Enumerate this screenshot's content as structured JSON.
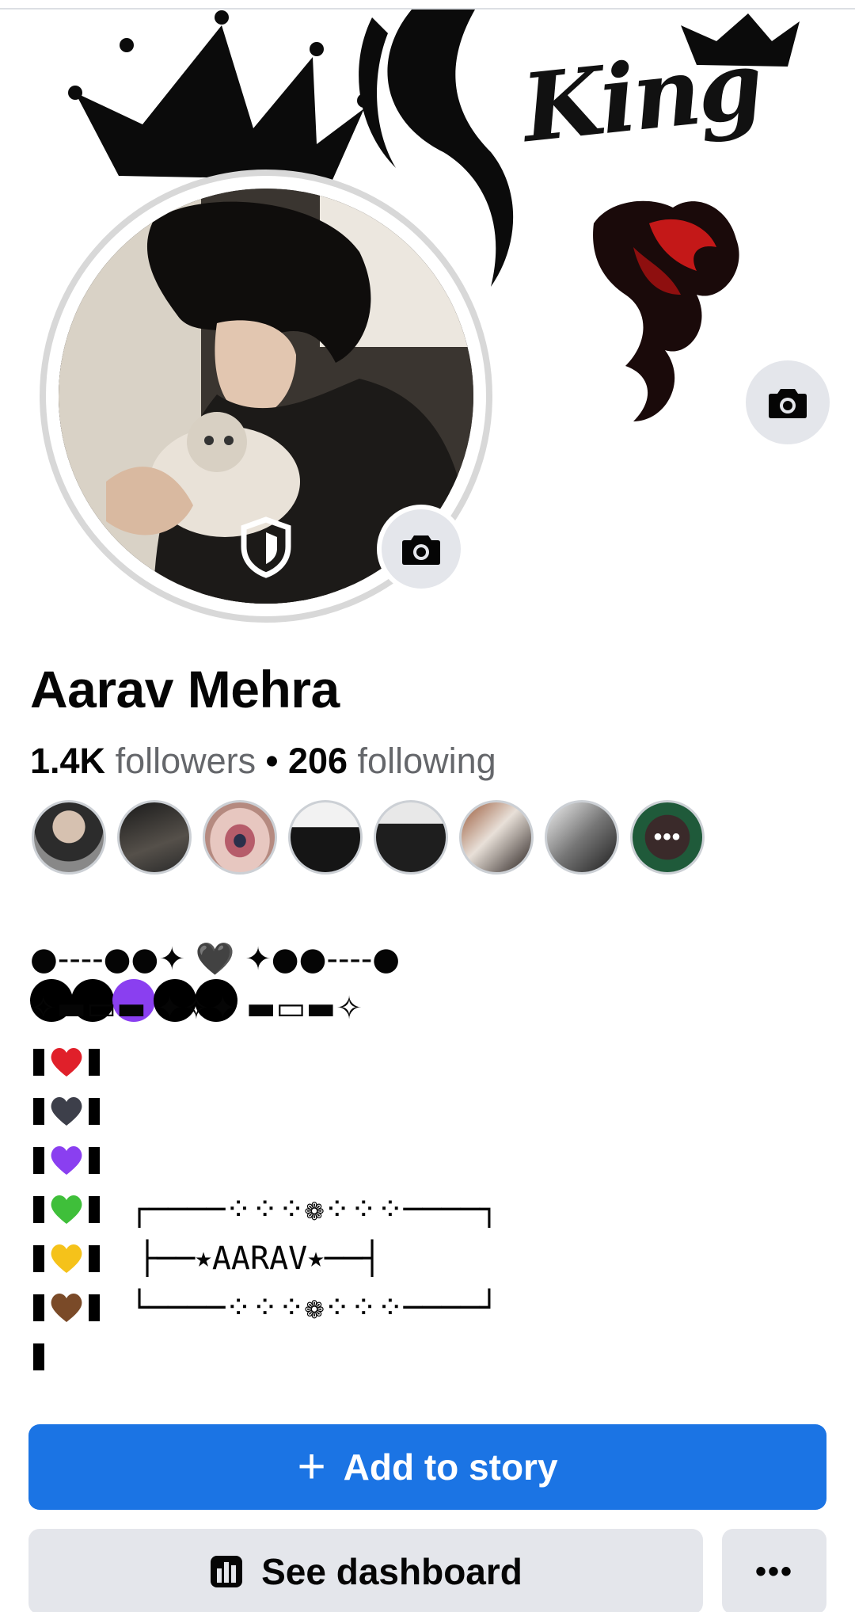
{
  "cover": {
    "logo_text": "King",
    "camera_icon": "camera-icon"
  },
  "profile": {
    "name": "Aarav Mehra",
    "followers_count": "1.4K",
    "followers_label": "followers",
    "separator": "•",
    "following_count": "206",
    "following_label": "following",
    "avatar_badge_icon": "shield-icon",
    "camera_icon": "camera-icon"
  },
  "friends": {
    "count_shown": 8,
    "more_icon": "more-dots-icon",
    "more_label": "•••"
  },
  "bio": {
    "line1": "●●🟣●●",
    "line2": "●----●●✦ 🖤 ✦●●----●",
    "line3": "✧▬▭▬ ✦✧✦ ▬▭▬✧",
    "hearts": [
      "❤️",
      "🖤",
      "💜",
      "💚",
      "💛",
      "🤎"
    ],
    "heart_colors": [
      "#e0202a",
      "#3d3f4a",
      "#8a3ff0",
      "#3fbf3a",
      "#f5c21a",
      "#7a4a28"
    ],
    "frame_top": "┌────⁘⁘⁘❁⁘⁘⁘────┐",
    "frame_mid": "├──⭑AARAV⭑──┤",
    "frame_bot": "└────⁘⁘⁘❁⁘⁘⁘────┘"
  },
  "actions": {
    "add_story_label": "Add to story",
    "add_story_icon": "plus-icon",
    "dashboard_label": "See dashboard",
    "dashboard_icon": "bar-chart-icon",
    "more_label": "•••"
  },
  "colors": {
    "primary": "#1b74e4",
    "secondary_bg": "#e4e6eb",
    "muted_text": "#65676b"
  }
}
